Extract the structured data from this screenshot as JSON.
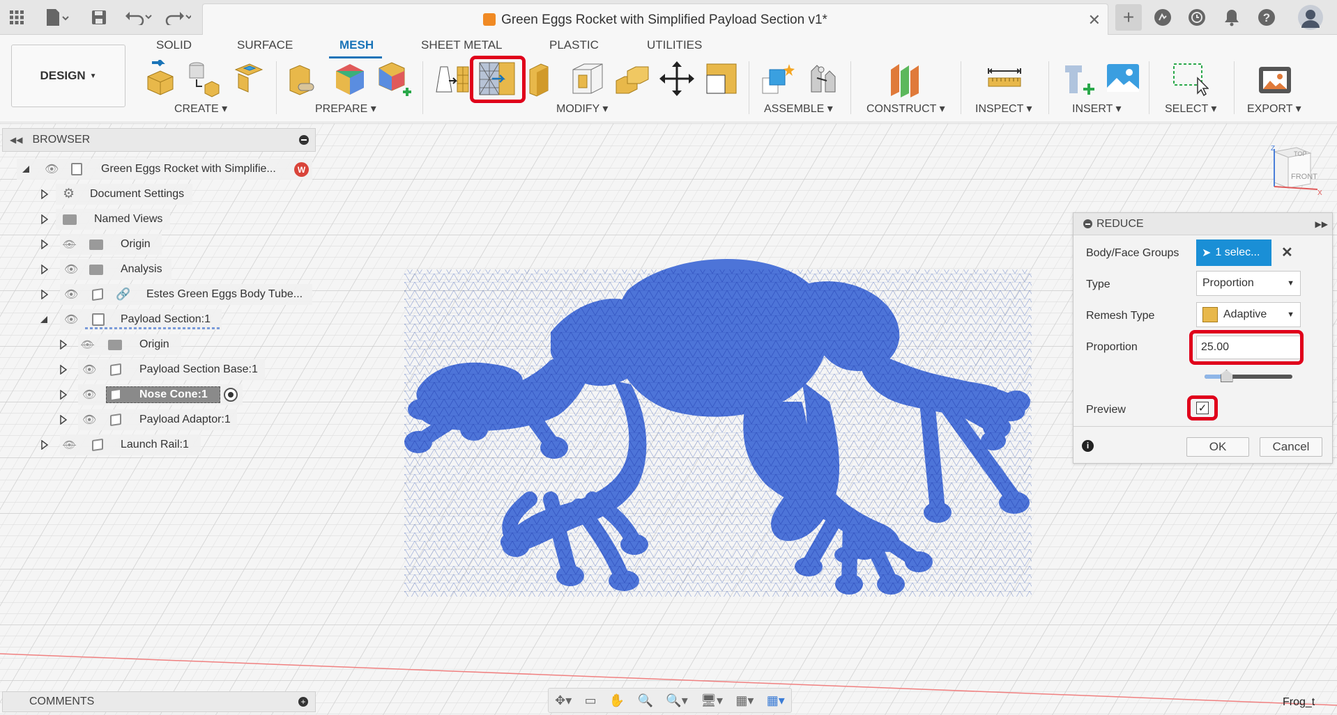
{
  "titlebar": {
    "doc_title": "Green Eggs Rocket with Simplified Payload Section v1*"
  },
  "toolbar": {
    "design_label": "DESIGN",
    "tabs": [
      "SOLID",
      "SURFACE",
      "MESH",
      "SHEET METAL",
      "PLASTIC",
      "UTILITIES"
    ],
    "active_tab": "MESH",
    "groups": [
      "CREATE",
      "PREPARE",
      "MODIFY",
      "ASSEMBLE",
      "CONSTRUCT",
      "INSPECT",
      "INSERT",
      "SELECT",
      "EXPORT"
    ]
  },
  "browser": {
    "title": "BROWSER",
    "root": "Green Eggs Rocket with Simplifie...",
    "items": [
      "Document Settings",
      "Named Views",
      "Origin",
      "Analysis",
      "Estes Green Eggs Body Tube...",
      "Payload Section:1",
      "Origin",
      "Payload Section Base:1",
      "Nose Cone:1",
      "Payload Adaptor:1",
      "Launch Rail:1"
    ]
  },
  "comments": {
    "label": "COMMENTS"
  },
  "reduce": {
    "title": "REDUCE",
    "body_label": "Body/Face Groups",
    "body_value": "1 selec...",
    "type_label": "Type",
    "type_value": "Proportion",
    "remesh_label": "Remesh Type",
    "remesh_value": "Adaptive",
    "proportion_label": "Proportion",
    "proportion_value": "25.00",
    "proportion_slider": 0.25,
    "preview_label": "Preview",
    "preview_checked": true,
    "ok": "OK",
    "cancel": "Cancel"
  },
  "viewcube": {
    "top": "TOP",
    "front": "FRONT"
  },
  "status": {
    "corner_text": "Frog_t"
  },
  "colors": {
    "accent": "#1a74b8",
    "highlight": "#e0001b",
    "mesh": "#4d74d8"
  }
}
